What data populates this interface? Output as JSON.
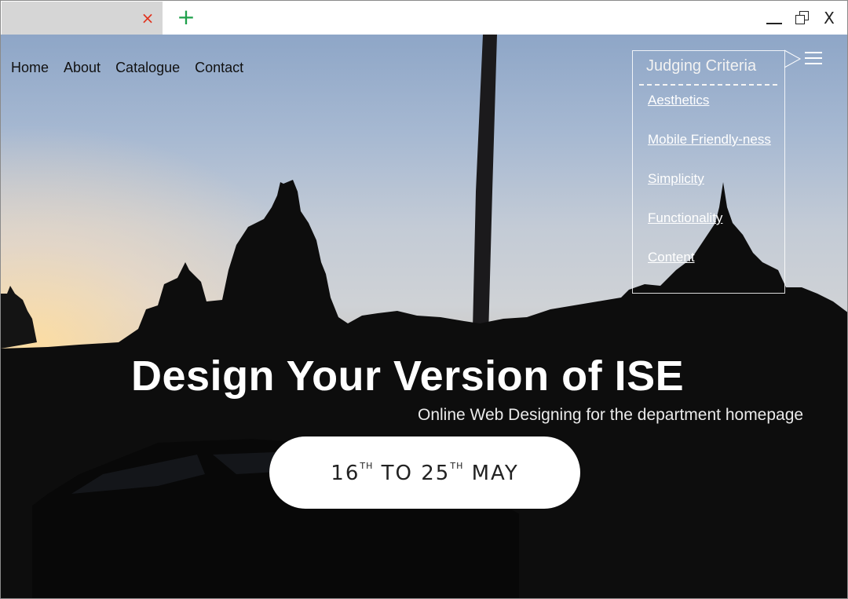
{
  "browser": {
    "tab_close_icon": "×",
    "new_tab_icon": "+",
    "window_close_icon": "X",
    "colors": {
      "tab_close": "#e0331e",
      "new_tab": "#1ea04a"
    }
  },
  "nav": {
    "items": [
      {
        "label": "Home"
      },
      {
        "label": "About"
      },
      {
        "label": "Catalogue"
      },
      {
        "label": "Contact"
      }
    ]
  },
  "menu": {
    "icon": "hamburger-icon",
    "title": "Judging Criteria",
    "items": [
      {
        "label": "Aesthetics"
      },
      {
        "label": "Mobile Friendly-ness"
      },
      {
        "label": "Simplicity"
      },
      {
        "label": "Functionality"
      },
      {
        "label": "Content"
      }
    ]
  },
  "hero": {
    "title": "Design Your Version of ISE",
    "subtitle": "Online Web Designing for the department homepage",
    "dates": {
      "start_day": "16",
      "start_suffix": "TH",
      "connector": "TO",
      "end_day": "25",
      "end_suffix": "TH",
      "month": "MAY"
    }
  }
}
